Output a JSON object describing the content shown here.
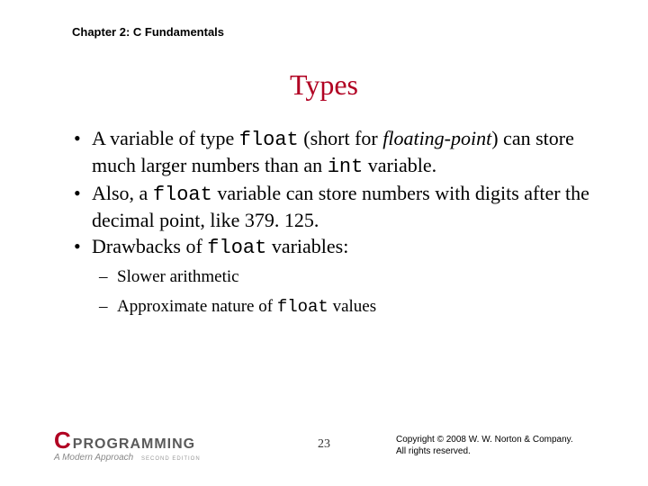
{
  "chapter": "Chapter 2: C Fundamentals",
  "title": "Types",
  "bullets": {
    "b1": {
      "t1": "A variable of type ",
      "code1": "float",
      "t2": " (short for ",
      "ital": "floating-point",
      "t3": ") can store much larger numbers than an ",
      "code2": "int",
      "t4": " variable."
    },
    "b2": {
      "t1": "Also, a ",
      "code1": "float",
      "t2": " variable can store numbers with digits after the decimal point, like 379. 125."
    },
    "b3": {
      "t1": "Drawbacks of ",
      "code1": "float",
      "t2": " variables:"
    },
    "sub1": "Slower arithmetic",
    "sub2": {
      "t1": "Approximate nature of ",
      "code1": "float",
      "t2": " values"
    }
  },
  "footer": {
    "logo_c": "C",
    "logo_prog": "PROGRAMMING",
    "logo_sub": "A Modern Approach",
    "logo_ed": "SECOND EDITION",
    "page": "23",
    "copy1": "Copyright © 2008 W. W. Norton & Company.",
    "copy2": "All rights reserved."
  }
}
